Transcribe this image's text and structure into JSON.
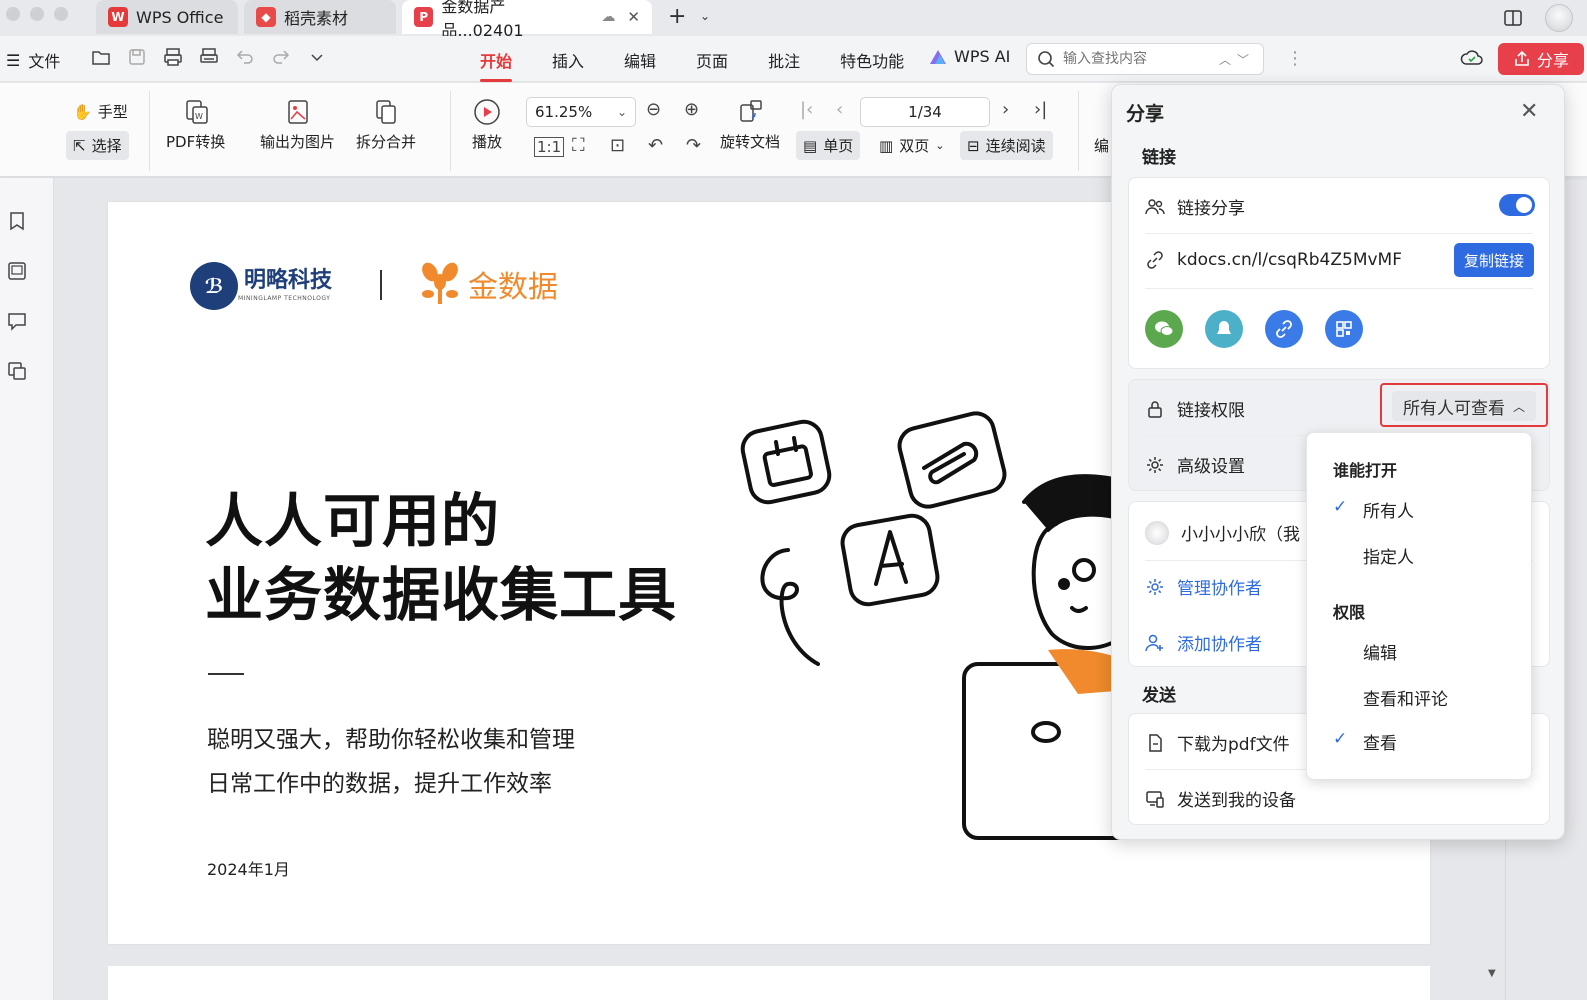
{
  "titlebar": {
    "tabs": [
      {
        "label": "WPS Office"
      },
      {
        "label": "稻壳素材"
      },
      {
        "label": "金数据产品...02401"
      }
    ]
  },
  "menubar": {
    "file_label": "文件",
    "tabs": [
      "开始",
      "插入",
      "编辑",
      "页面",
      "批注",
      "特色功能"
    ],
    "active_tab": "开始",
    "wps_ai": "WPS AI",
    "search_placeholder": "输入查找内容",
    "share_label": "分享"
  },
  "ribbon": {
    "hand": "手型",
    "select": "选择",
    "pdf_convert": "PDF转换",
    "export_image": "输出为图片",
    "split_merge": "拆分合并",
    "play": "播放",
    "zoom": "61.25%",
    "rotate": "旋转文档",
    "page_indicator": "1/34",
    "single_page": "单页",
    "double_page": "双页",
    "continuous": "连续阅读",
    "edit_partial": "编"
  },
  "document": {
    "logo_company": "明略科技",
    "logo_company_sub": "MININGLAMP TECHNOLOGY",
    "logo_brand": "金数据",
    "headline_1": "人人可用的",
    "headline_2": "业务数据收集工具",
    "tagline_1": "聪明又强大，帮助你轻松收集和管理",
    "tagline_2": "日常工作中的数据，提升工作效率",
    "date": "2024年1月"
  },
  "share_panel": {
    "title": "分享",
    "link_section": "链接",
    "link_share": "链接分享",
    "link_url": "kdocs.cn/l/csqRb4Z5MvMF",
    "copy_link": "复制链接",
    "link_permission": "链接权限",
    "permission_value": "所有人可查看",
    "advanced": "高级设置",
    "collaborator": "小小小小欣（我",
    "manage_collab": "管理协作者",
    "add_collab": "添加协作者",
    "send_section": "发送",
    "download_pdf": "下载为pdf文件",
    "send_device": "发送到我的设备"
  },
  "dropdown": {
    "who_header": "谁能打开",
    "who_options": [
      "所有人",
      "指定人"
    ],
    "who_selected": "所有人",
    "perm_header": "权限",
    "perm_options": [
      "编辑",
      "查看和评论",
      "查看"
    ],
    "perm_selected": "查看"
  },
  "colors": {
    "accent_red": "#e8404a",
    "accent_blue": "#2f6be0",
    "brand_orange": "#f08a2c"
  }
}
